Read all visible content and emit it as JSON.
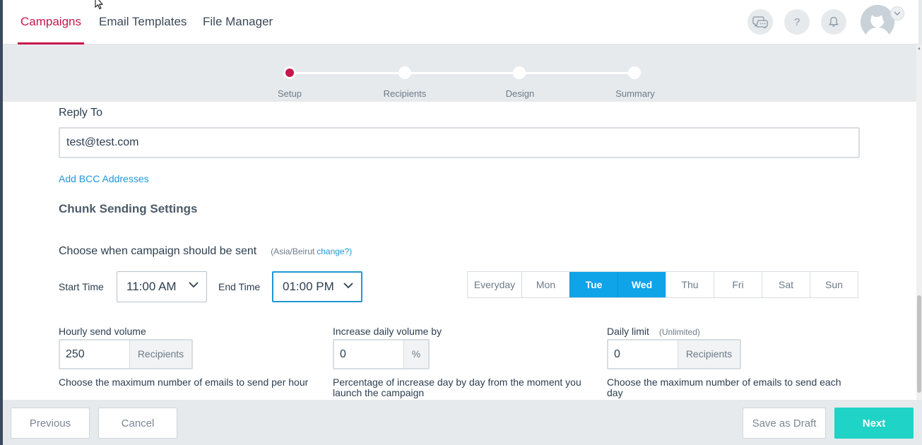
{
  "nav": {
    "tabs": [
      {
        "label": "Campaigns",
        "active": true
      },
      {
        "label": "Email Templates",
        "active": false
      },
      {
        "label": "File Manager",
        "active": false
      }
    ],
    "icons": [
      "chat-icon",
      "help-icon",
      "bell-icon",
      "avatar"
    ],
    "help_glyph": "?"
  },
  "stepper": {
    "steps": [
      {
        "label": "Setup",
        "active": true
      },
      {
        "label": "Recipients",
        "active": false
      },
      {
        "label": "Design",
        "active": false
      },
      {
        "label": "Summary",
        "active": false
      }
    ],
    "accent": "#c8174b"
  },
  "form": {
    "reply_to": {
      "label": "Reply To",
      "value": "test@test.com"
    },
    "add_bcc_link": "Add BCC Addresses",
    "chunk_heading": "Chunk Sending Settings",
    "schedule": {
      "title": "Choose when campaign should be sent",
      "timezone": "(Asia/Beirut",
      "change_link": "change?)",
      "start_label": "Start Time",
      "start_value": "11:00 AM",
      "end_label": "End Time",
      "end_value": "01:00 PM",
      "days": [
        {
          "label": "Everyday",
          "selected": false
        },
        {
          "label": "Mon",
          "selected": false
        },
        {
          "label": "Tue",
          "selected": true
        },
        {
          "label": "Wed",
          "selected": true
        },
        {
          "label": "Thu",
          "selected": false
        },
        {
          "label": "Fri",
          "selected": false
        },
        {
          "label": "Sat",
          "selected": false
        },
        {
          "label": "Sun",
          "selected": false
        }
      ],
      "selected_color": "#0fa3e8"
    },
    "hourly": {
      "label": "Hourly send volume",
      "value": "250",
      "addon": "Recipients",
      "help": "Choose the maximum number of emails to send per hour"
    },
    "increase": {
      "label": "Increase daily volume by",
      "value": "0",
      "addon": "%",
      "help": "Percentage of increase day by day from the moment you launch the campaign"
    },
    "daily_limit": {
      "label": "Daily limit",
      "note": "(Unlimited)",
      "value": "0",
      "addon": "Recipients",
      "help": "Choose the maximum number of emails to send each day"
    }
  },
  "footer": {
    "previous": "Previous",
    "cancel": "Cancel",
    "save_draft": "Save as Draft",
    "next": "Next",
    "next_color": "#1fd3c6"
  }
}
